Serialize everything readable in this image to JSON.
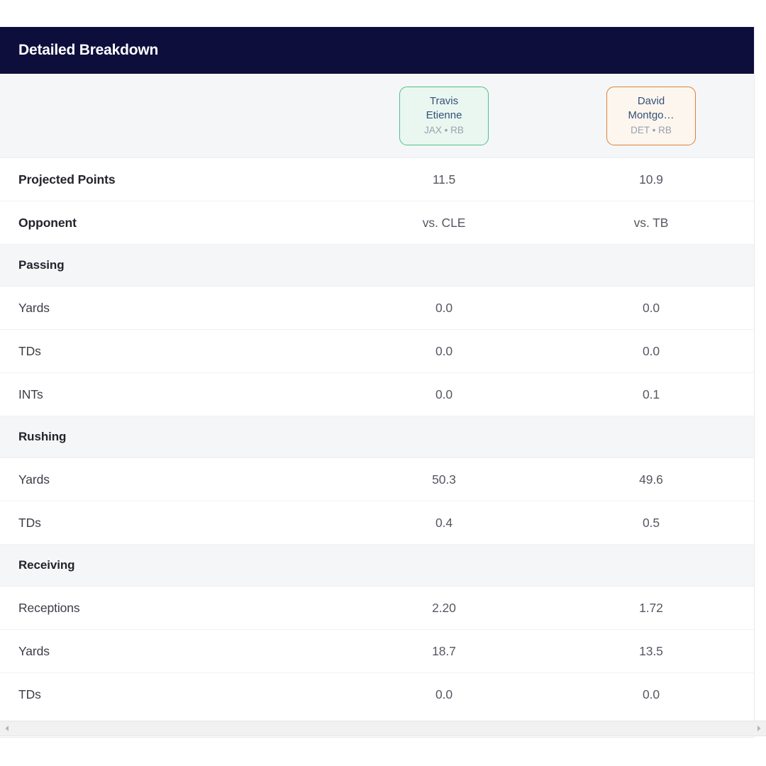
{
  "card": {
    "header_title": "Detailed Breakdown"
  },
  "columns": [
    {
      "label": "",
      "type": "label"
    },
    {
      "player_name_line1": "Travis",
      "player_name_line2": "Etienne",
      "meta": "JAX • RB",
      "accent": "#4fbf8b",
      "fill": "#eaf7f0"
    },
    {
      "player_name_line1": "David",
      "player_name_line2": "Montgo…",
      "meta": "DET • RB",
      "accent": "#d98236",
      "fill": "#fdf6ef"
    }
  ],
  "rows": [
    {
      "kind": "stat",
      "emphasis": true,
      "label": "Projected Points",
      "values": [
        "11.5",
        "10.9"
      ]
    },
    {
      "kind": "stat",
      "emphasis": true,
      "label": "Opponent",
      "values": [
        "vs. CLE",
        "vs. TB"
      ]
    },
    {
      "kind": "section",
      "label": "Passing"
    },
    {
      "kind": "stat",
      "emphasis": false,
      "label": "Yards",
      "values": [
        "0.0",
        "0.0"
      ]
    },
    {
      "kind": "stat",
      "emphasis": false,
      "label": "TDs",
      "values": [
        "0.0",
        "0.0"
      ]
    },
    {
      "kind": "stat",
      "emphasis": false,
      "label": "INTs",
      "values": [
        "0.0",
        "0.1"
      ]
    },
    {
      "kind": "section",
      "label": "Rushing"
    },
    {
      "kind": "stat",
      "emphasis": false,
      "label": "Yards",
      "values": [
        "50.3",
        "49.6"
      ]
    },
    {
      "kind": "stat",
      "emphasis": false,
      "label": "TDs",
      "values": [
        "0.4",
        "0.5"
      ]
    },
    {
      "kind": "section",
      "label": "Receiving"
    },
    {
      "kind": "stat",
      "emphasis": false,
      "label": "Receptions",
      "values": [
        "2.20",
        "1.72"
      ]
    },
    {
      "kind": "stat",
      "emphasis": false,
      "label": "Yards",
      "values": [
        "18.7",
        "13.5"
      ]
    },
    {
      "kind": "stat",
      "emphasis": false,
      "label": "TDs",
      "values": [
        "0.0",
        "0.0"
      ]
    }
  ],
  "scrollbar": {
    "left_arrow_icon": "chevron-left-icon",
    "right_arrow_icon": "chevron-right-icon"
  },
  "theme": {
    "header_bg": "#0e0e3d",
    "header_text": "#ffffff",
    "section_bg": "#f5f6f8",
    "row_bg": "#ffffff",
    "label_text": "#3c3d46",
    "value_text": "#555862",
    "player_name_text": "#34507a",
    "player_meta_text": "#9aa1ac"
  }
}
